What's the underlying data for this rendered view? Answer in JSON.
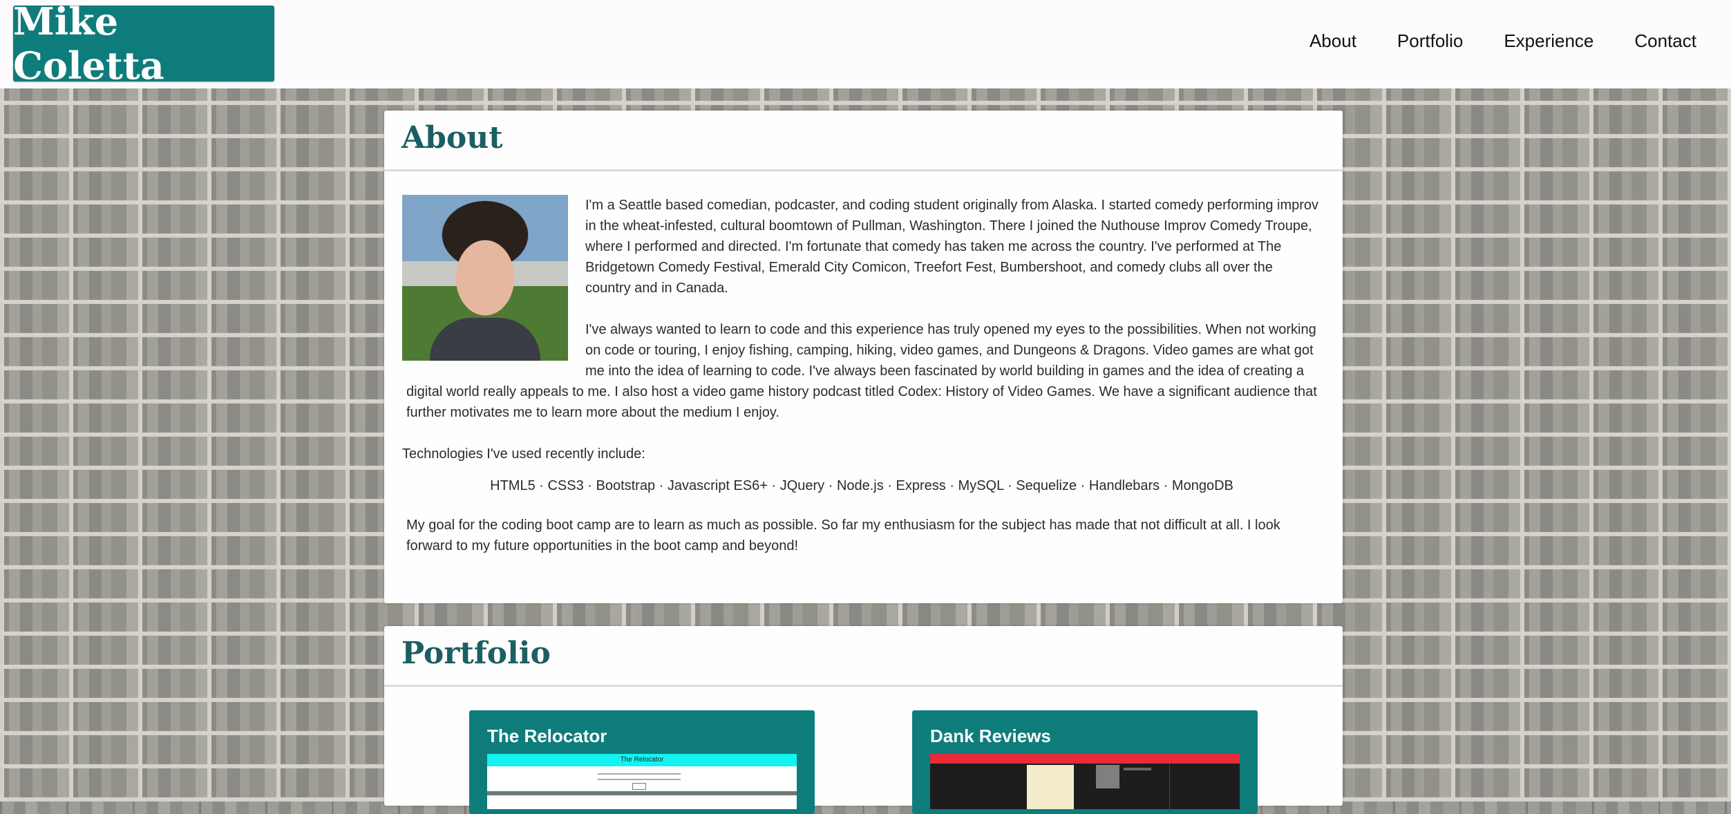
{
  "brand": {
    "name": "Mike Coletta",
    "color": "#0f7c7c"
  },
  "nav": {
    "items": [
      "About",
      "Portfolio",
      "Experience",
      "Contact"
    ]
  },
  "about": {
    "title": "About",
    "photo_alt": "portrait photo",
    "paragraph1": "I'm a Seattle based comedian, podcaster, and coding student originally from Alaska. I started comedy performing improv in the wheat-infested, cultural boomtown of Pullman, Washington. There I joined the Nuthouse Improv Comedy Troupe, where I performed and directed. I'm fortunate that comedy has taken me across the country. I've performed at The Bridgetown Comedy Festival, Emerald City Comicon, Treefort Fest, Bumbershoot, and comedy clubs all over the country and in Canada.",
    "paragraph2": "I've always wanted to learn to code and this experience has truly opened my eyes to the possibilities. When not working on code or touring, I enjoy fishing, camping, hiking, video games, and Dungeons & Dragons. Video games are what got me into the idea of learning to code. I've always been fascinated by world building in games and the idea of creating a digital world really appeals to me. I also host a video game history podcast titled Codex: History of Video Games. We have a significant audience that further motivates me to learn more about the medium I enjoy.",
    "tech_intro": "Technologies I've used recently include:",
    "tech_list": "HTML5 · CSS3 · Bootstrap · Javascript ES6+ · JQuery · Node.js · Express · MySQL · Sequelize · Handlebars · MongoDB",
    "goal": "My goal for the coding boot camp are to learn as much as possible. So far my enthusiasm for the subject has made that not difficult at all. I look forward to my future opportunities in the boot camp and beyond!"
  },
  "portfolio": {
    "title": "Portfolio",
    "projects": [
      {
        "title": "The Relocator",
        "screenshot_header": "The Relocator"
      },
      {
        "title": "Dank Reviews"
      }
    ]
  }
}
